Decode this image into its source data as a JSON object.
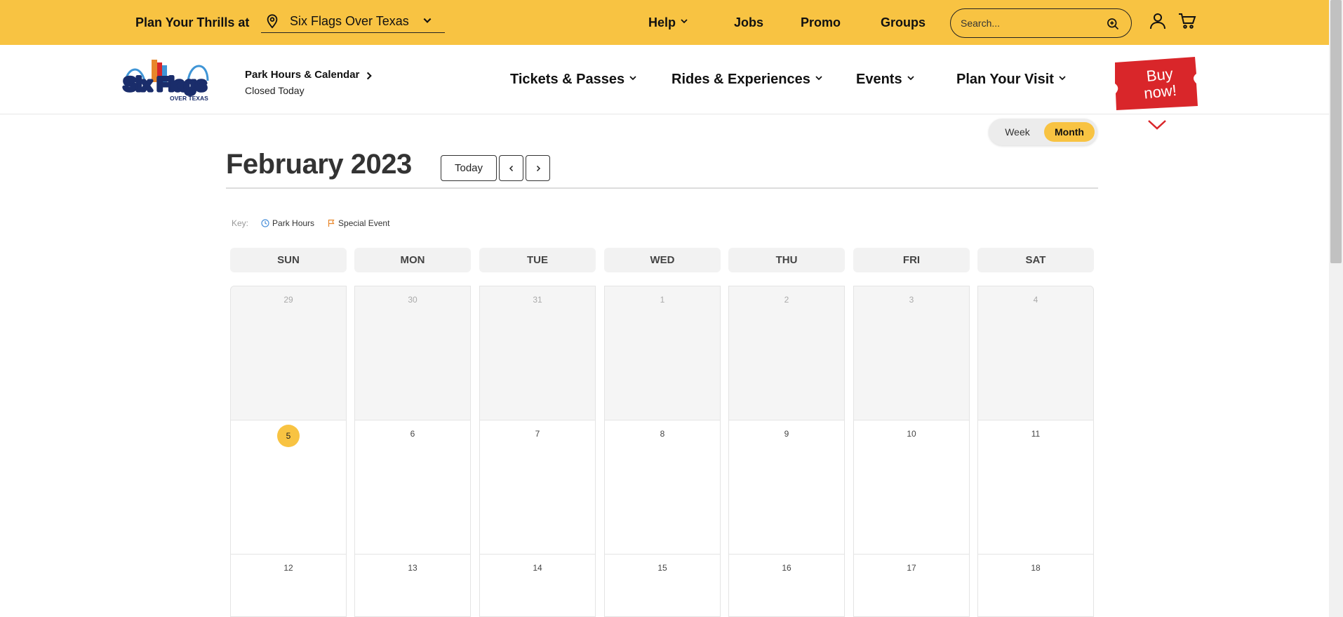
{
  "topbar": {
    "plan_label": "Plan Your Thrills at",
    "park": "Six Flags Over Texas",
    "nav": [
      "Help",
      "Jobs",
      "Promo",
      "Groups"
    ],
    "search_placeholder": "Search..."
  },
  "header": {
    "hours_title": "Park Hours & Calendar",
    "hours_status": "Closed Today",
    "nav": [
      "Tickets & Passes",
      "Rides & Experiences",
      "Events",
      "Plan Your Visit"
    ],
    "buy_line1": "Buy",
    "buy_line2": "now!",
    "logo_brand": "Six Flags",
    "logo_sub": "OVER TEXAS"
  },
  "view_toggle": {
    "week": "Week",
    "month": "Month",
    "selected": "Month"
  },
  "calendar": {
    "title": "February 2023",
    "today_label": "Today",
    "key_label": "Key:",
    "key_items": [
      "Park Hours",
      "Special Event"
    ],
    "days": [
      "SUN",
      "MON",
      "TUE",
      "WED",
      "THU",
      "FRI",
      "SAT"
    ],
    "weeks": [
      [
        "29",
        "30",
        "31",
        "1",
        "2",
        "3",
        "4"
      ],
      [
        "5",
        "6",
        "7",
        "8",
        "9",
        "10",
        "11"
      ],
      [
        "12",
        "13",
        "14",
        "15",
        "16",
        "17",
        "18"
      ]
    ],
    "today": "5"
  },
  "colors": {
    "brand_yellow": "#f8c342",
    "buy_red": "#d9262a",
    "key_blue": "#4a90d9",
    "key_orange": "#e8862a"
  }
}
